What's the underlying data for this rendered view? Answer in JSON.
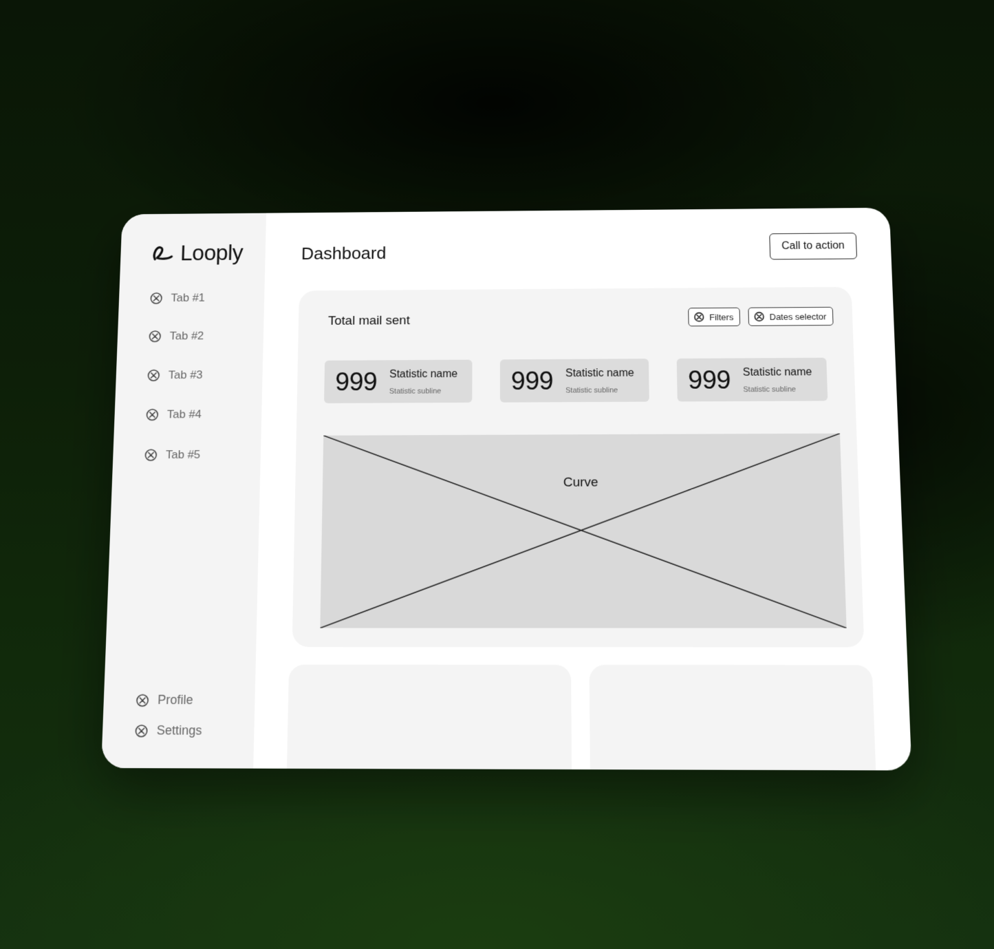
{
  "app": {
    "brand": "Looply",
    "logo_icon": "looply-logo-icon"
  },
  "sidebar": {
    "items": [
      {
        "label": "Tab #1",
        "icon": "x-circle-icon"
      },
      {
        "label": "Tab #2",
        "icon": "x-circle-icon"
      },
      {
        "label": "Tab #3",
        "icon": "x-circle-icon"
      },
      {
        "label": "Tab #4",
        "icon": "x-circle-icon"
      },
      {
        "label": "Tab #5",
        "icon": "x-circle-icon"
      }
    ],
    "bottom": [
      {
        "label": "Profile",
        "icon": "x-circle-icon"
      },
      {
        "label": "Settings",
        "icon": "x-circle-icon"
      }
    ]
  },
  "header": {
    "title": "Dashboard",
    "cta_label": "Call to action"
  },
  "panel": {
    "title": "Total mail sent",
    "filters_label": "Filters",
    "dates_label": "Dates selector",
    "stats": [
      {
        "value": "999",
        "name": "Statistic name",
        "subline": "Statistic subline"
      },
      {
        "value": "999",
        "name": "Statistic name",
        "subline": "Statistic subline"
      },
      {
        "value": "999",
        "name": "Statistic name",
        "subline": "Statistic subline"
      }
    ],
    "chart_placeholder_label": "Curve"
  },
  "colors": {
    "background": "#0d1f08",
    "sidebar": "#f4f4f4",
    "panel": "#f4f4f4",
    "stat_card": "#dcdcdc",
    "placeholder": "#d9d9d9"
  }
}
